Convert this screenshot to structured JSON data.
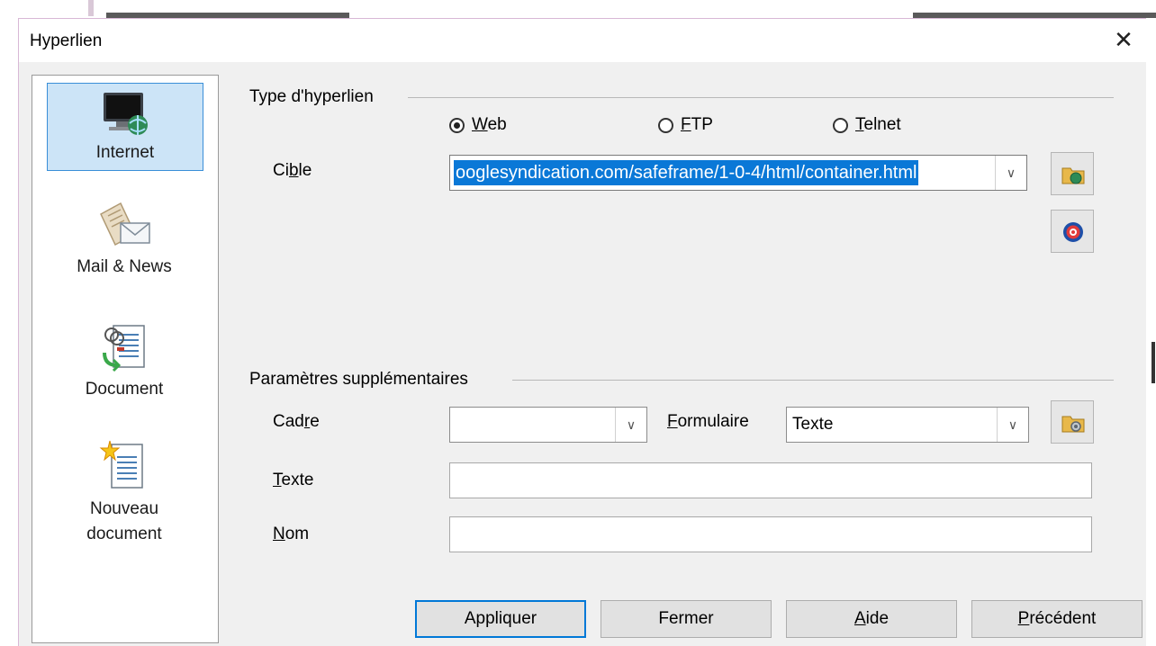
{
  "dialog": {
    "title": "Hyperlien",
    "close_icon": "close-icon"
  },
  "sidebar": {
    "items": [
      {
        "label": "Internet",
        "icon": "internet-globe-monitor-icon",
        "selected": true
      },
      {
        "label": "Mail & News",
        "icon": "mail-news-icon",
        "selected": false
      },
      {
        "label": "Document",
        "icon": "document-link-icon",
        "selected": false
      },
      {
        "label_line1": "Nouveau",
        "label_line2": "document",
        "icon": "new-document-icon",
        "selected": false
      }
    ]
  },
  "hyperlink_type": {
    "section_label": "Type d'hyperlien",
    "options": [
      {
        "prefix": "",
        "accel": "W",
        "rest": "eb",
        "selected": true
      },
      {
        "prefix": "",
        "accel": "F",
        "rest": "TP",
        "selected": false
      },
      {
        "prefix": "",
        "accel": "T",
        "rest": "elnet",
        "selected": false
      }
    ],
    "target_label_pre": "Ci",
    "target_label_accel": "b",
    "target_label_post": "le",
    "target_value": "ooglesyndication.com/safeframe/1-0-4/html/container.html"
  },
  "extra": {
    "section_label": "Paramètres supplémentaires",
    "frame_label_pre": "Cad",
    "frame_label_accel": "r",
    "frame_label_post": "e",
    "frame_value": "",
    "form_label_pre": "",
    "form_label_accel": "F",
    "form_label_post": "ormulaire",
    "form_value": "Texte",
    "text_label_accel": "T",
    "text_label_post": "exte",
    "text_value": "",
    "name_label_accel": "N",
    "name_label_post": "om",
    "name_value": ""
  },
  "buttons": {
    "apply": "Appliquer",
    "close": "Fermer",
    "help_accel": "A",
    "help_rest": "ide",
    "prev_accel": "P",
    "prev_rest": "récédent"
  },
  "colors": {
    "selection": "#0a78d7",
    "sidebar_selected": "#cce4f7",
    "default_button_border": "#0078d7"
  }
}
